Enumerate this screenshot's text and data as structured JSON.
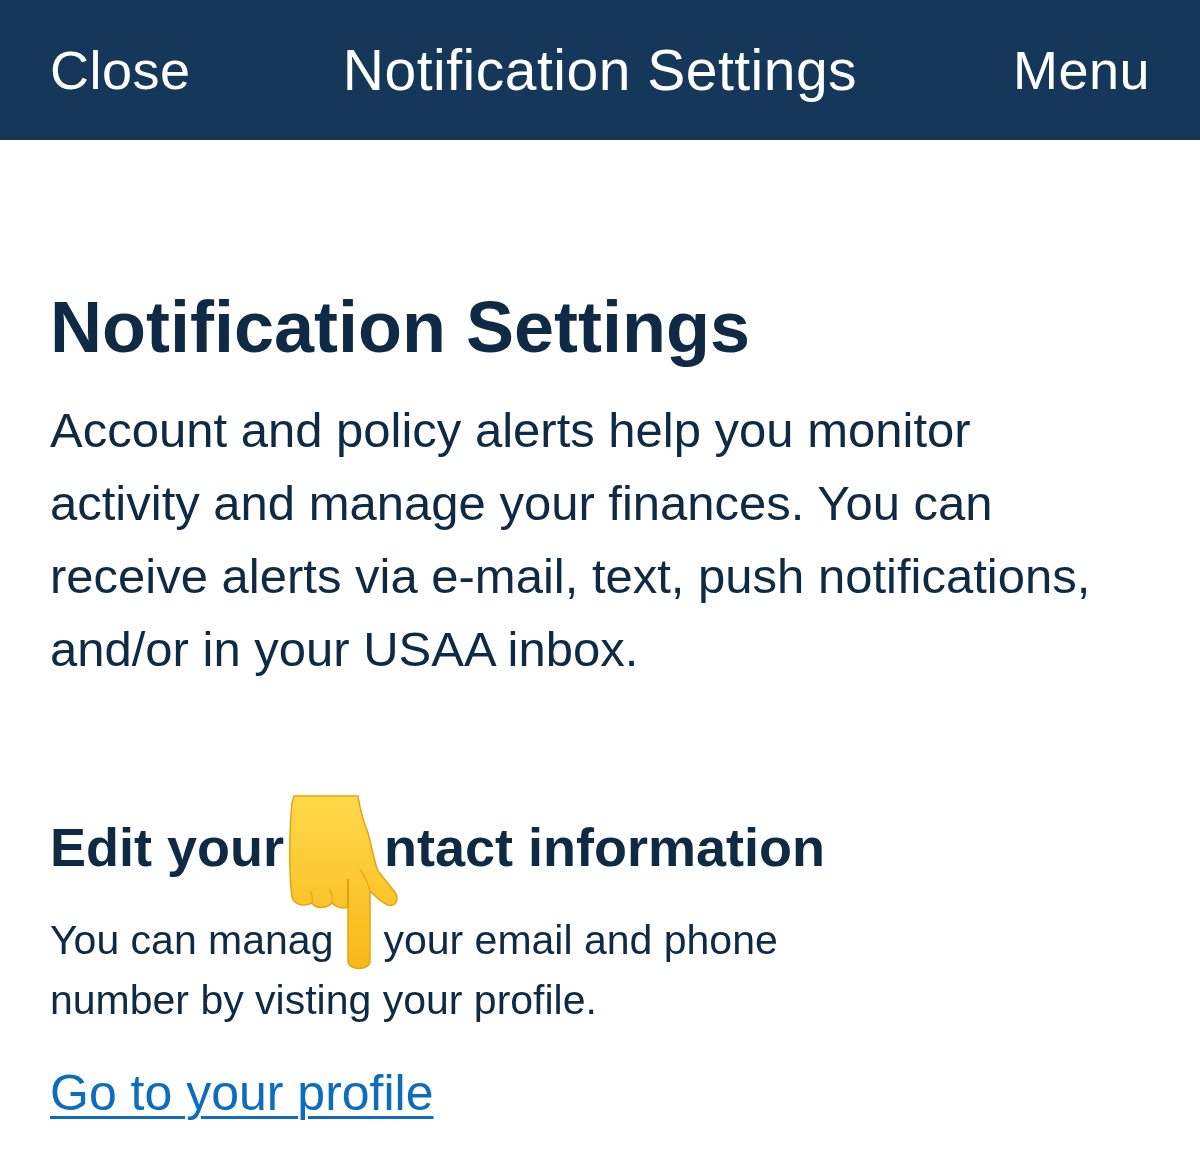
{
  "header": {
    "close_label": "Close",
    "title": "Notification Settings",
    "menu_label": "Menu"
  },
  "page_title": "Notification Settings",
  "intro_lines": [
    "Account and policy alerts help you monitor",
    "activity and manage your finances. You can",
    "receive alerts via e-mail, text, push notifications,",
    "and/or in your USAA inbox."
  ],
  "contact_section": {
    "heading_parts": [
      "Edit your",
      "ntact information"
    ],
    "text_lines": [
      [
        "You can manag",
        "your email and phone"
      ],
      [
        "number by visting your profile."
      ]
    ],
    "link": "Go to your profile"
  }
}
